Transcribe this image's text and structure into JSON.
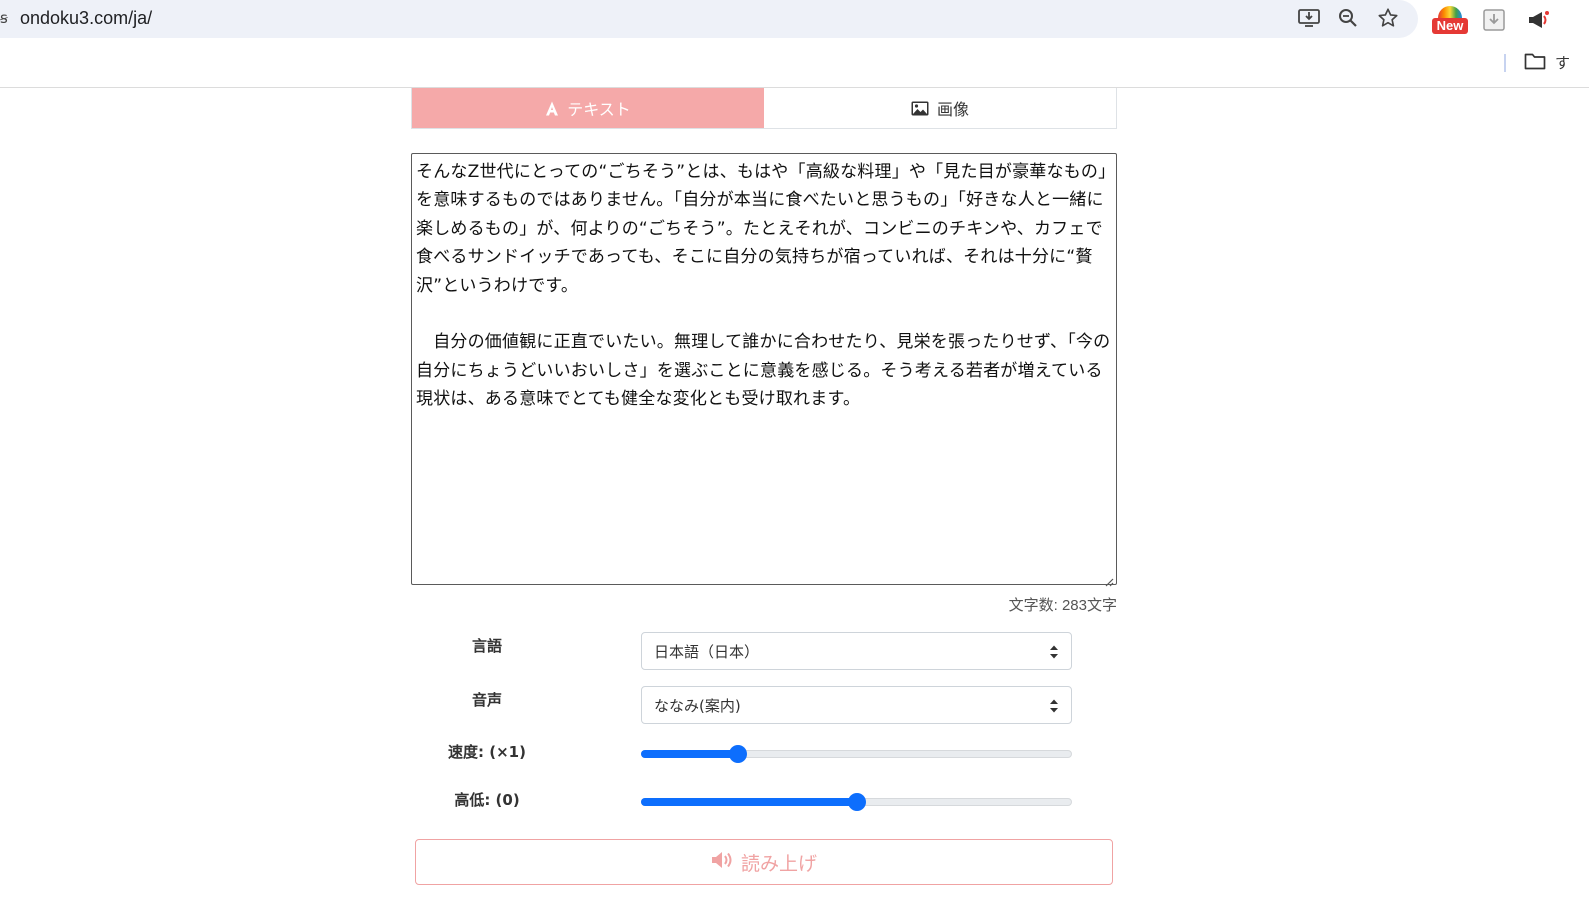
{
  "browser": {
    "url": "ondoku3.com/ja/",
    "new_badge": "New",
    "bookmark_folder_label": "す"
  },
  "tabs": [
    {
      "label": "テキスト",
      "active": true
    },
    {
      "label": "画像",
      "active": false
    }
  ],
  "textarea": {
    "value": "そんなZ世代にとっての“ごちそう”とは、もはや「高級な料理」や「見た目が豪華なもの」を意味するものではありません。「自分が本当に食べたいと思うもの」「好きな人と一緒に楽しめるもの」が、何よりの“ごちそう”。たとえそれが、コンビニのチキンや、カフェで食べるサンドイッチであっても、そこに自分の気持ちが宿っていれば、それは十分に“贅沢”というわけです。\n\n　自分の価値観に正直でいたい。無理して誰かに合わせたり、見栄を張ったりせず、「今の自分にちょうどいいおいしさ」を選ぶことに意義を感じる。そう考える若者が増えている現状は、ある意味でとても健全な変化とも受け取れます。"
  },
  "char_count": "文字数: 283文字",
  "settings": {
    "language": {
      "label": "言語",
      "value": "日本語（日本）"
    },
    "voice": {
      "label": "音声",
      "value": "ななみ(案内)"
    },
    "speed": {
      "label": "速度: (×1)",
      "fraction": 0.225
    },
    "pitch": {
      "label": "高低: (0)",
      "fraction": 0.5
    }
  },
  "read_button": {
    "label": "読み上げ"
  },
  "colors": {
    "accent_pink": "#f5a9a9",
    "slider_blue": "#0d6efd"
  }
}
